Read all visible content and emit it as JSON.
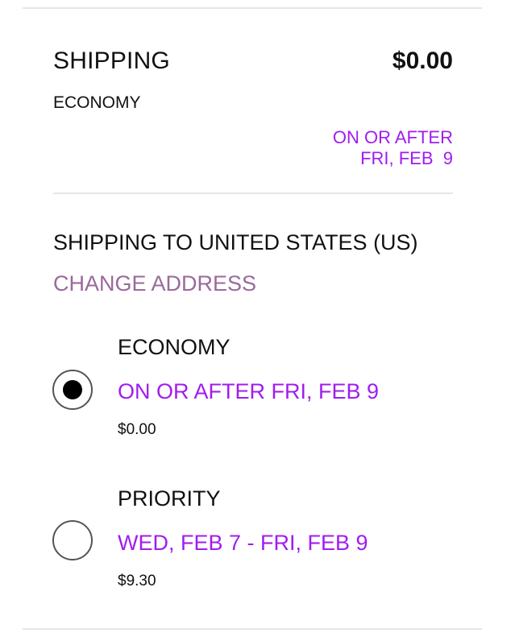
{
  "summary": {
    "title": "SHIPPING",
    "price": "$0.00",
    "method": "ECONOMY",
    "eta_line1": "ON OR AFTER",
    "eta_line2": "FRI, FEB  9"
  },
  "destination": {
    "label": "SHIPPING TO UNITED STATES (US)",
    "change_link": "CHANGE ADDRESS"
  },
  "options": [
    {
      "name": "ECONOMY",
      "eta": "ON OR AFTER FRI, FEB 9",
      "price": "$0.00",
      "selected": true
    },
    {
      "name": "PRIORITY",
      "eta": "WED, FEB 7 - FRI, FEB 9",
      "price": "$9.30",
      "selected": false
    }
  ],
  "colors": {
    "accent": "#a11cf0",
    "link": "#9a6a9a",
    "divider": "#e6e6e6"
  }
}
